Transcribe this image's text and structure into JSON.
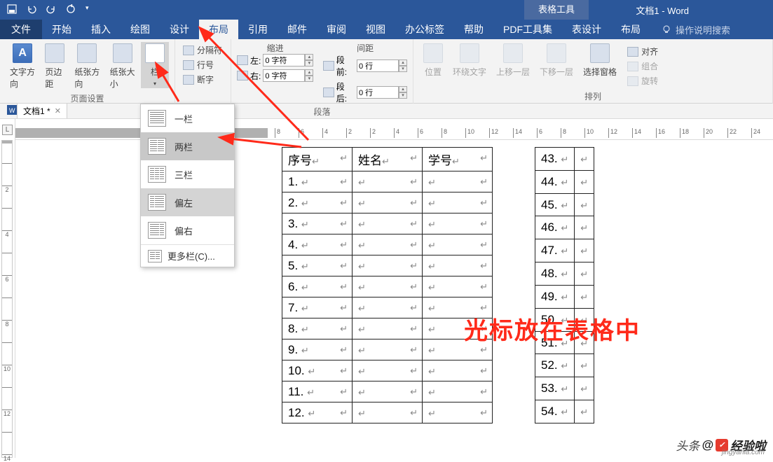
{
  "titlebar": {
    "tablet_tools": "表格工具",
    "doc_title": "文档1 - Word"
  },
  "tabs": {
    "file": "文件",
    "home": "开始",
    "insert": "插入",
    "draw": "绘图",
    "design": "设计",
    "layout": "布局",
    "references": "引用",
    "mailings": "邮件",
    "review": "审阅",
    "view": "视图",
    "office_tab": "办公标签",
    "help": "帮助",
    "pdf_tools": "PDF工具集",
    "table_design": "表设计",
    "table_layout": "布局",
    "tellme": "操作说明搜索"
  },
  "ribbon": {
    "page_setup_label": "页面设置",
    "paragraph_label": "段落",
    "arrange_label": "排列",
    "text_direction": "文字方向",
    "margins": "页边距",
    "orientation": "纸张方向",
    "size": "纸张大小",
    "columns": "栏",
    "breaks": "分隔符",
    "line_numbers": "行号",
    "hyphenation": "断字",
    "indent_label": "缩进",
    "spacing_label": "间距",
    "indent_left_lbl": "左:",
    "indent_right_lbl": "右:",
    "indent_left": "0 字符",
    "indent_right": "0 字符",
    "before_lbl": "段前:",
    "after_lbl": "段后:",
    "spacing_before": "0 行",
    "spacing_after": "0 行",
    "position": "位置",
    "wrap_text": "环绕文字",
    "bring_forward": "上移一层",
    "send_backward": "下移一层",
    "selection_pane": "选择窗格",
    "align": "对齐",
    "group": "组合",
    "rotate": "旋转"
  },
  "columns_menu": {
    "one": "一栏",
    "two": "两栏",
    "three": "三栏",
    "left": "偏左",
    "right": "偏右",
    "more": "更多栏(C)..."
  },
  "doc_tab": {
    "name": "文档1 *"
  },
  "table": {
    "headers": [
      "序号",
      "姓名",
      "学号"
    ],
    "rows": [
      "1.",
      "2.",
      "3.",
      "4.",
      "5.",
      "6.",
      "7.",
      "8.",
      "9.",
      "10.",
      "11.",
      "12."
    ],
    "right_rows": [
      "43.",
      "44.",
      "45.",
      "46.",
      "47.",
      "48.",
      "49.",
      "50.",
      "51.",
      "52.",
      "53.",
      "54."
    ]
  },
  "annotation": "光标放在表格中",
  "watermark": {
    "prefix": "头条",
    "brand": "@",
    "name": "经验啦",
    "site": "jingyanla.com"
  },
  "ruler": {
    "marks": [
      "8",
      "6",
      "4",
      "2",
      "2",
      "4",
      "6",
      "8",
      "10",
      "12",
      "14",
      "6",
      "8",
      "10",
      "12",
      "14",
      "16",
      "18",
      "20",
      "22",
      "24"
    ]
  },
  "chart_data": {
    "type": "table",
    "note": "Word document table, not a data chart"
  }
}
